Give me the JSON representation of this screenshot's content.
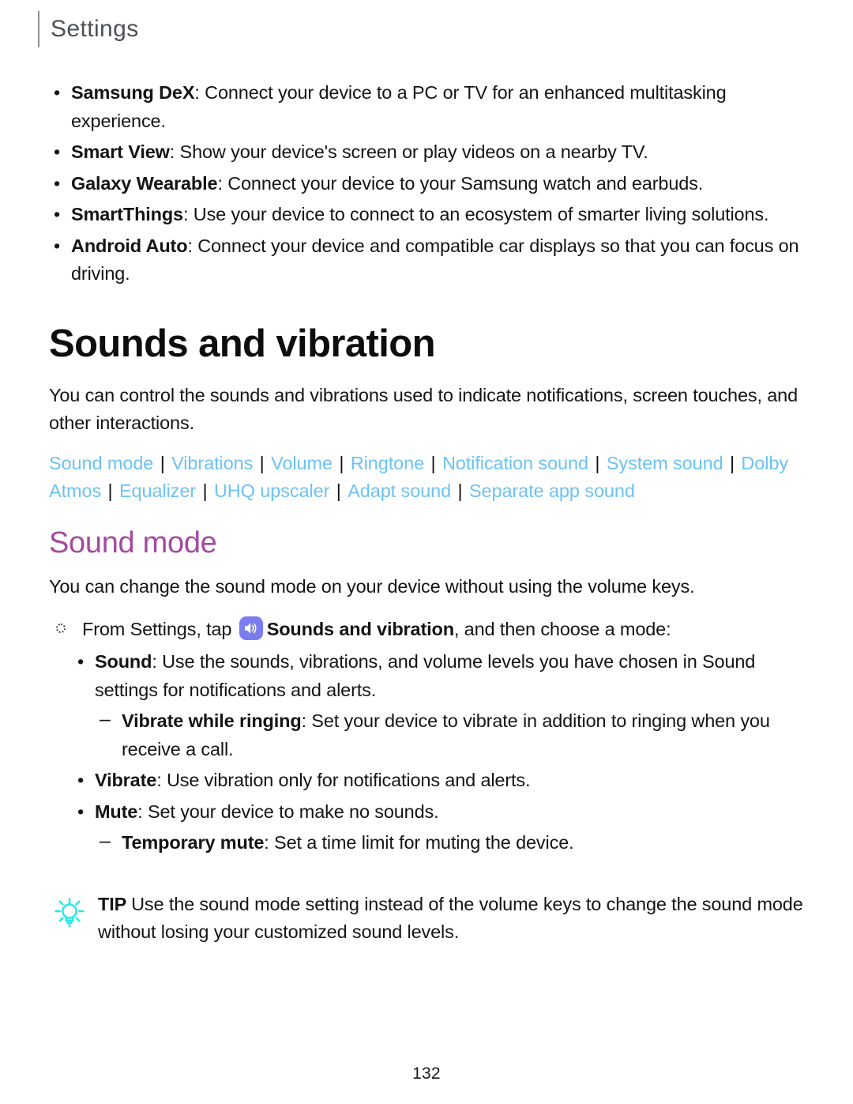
{
  "header": {
    "title": "Settings"
  },
  "top_bullets": [
    {
      "term": "Samsung DeX",
      "text": ": Connect your device to a PC or TV for an enhanced multitasking experience."
    },
    {
      "term": "Smart View",
      "text": ": Show your device's screen or play videos on a nearby TV."
    },
    {
      "term": "Galaxy Wearable",
      "text": ": Connect your device to your Samsung watch and earbuds."
    },
    {
      "term": "SmartThings",
      "text": ": Use your device to connect to an ecosystem of smarter living solutions."
    },
    {
      "term": "Android Auto",
      "text": ": Connect your device and compatible car displays so that you can focus on driving."
    }
  ],
  "section": {
    "heading": "Sounds and vibration",
    "intro": "You can control the sounds and vibrations used to indicate notifications, screen touches, and other interactions."
  },
  "links": {
    "separator": "|",
    "items": [
      "Sound mode",
      "Vibrations",
      "Volume",
      "Ringtone",
      "Notification sound",
      "System sound",
      "Dolby Atmos",
      "Equalizer",
      "UHQ upscaler",
      "Adapt sound",
      "Separate app sound"
    ]
  },
  "subsection": {
    "heading": "Sound mode",
    "intro": "You can change the sound mode on your device without using the volume keys.",
    "step": {
      "text_before_icon": "From Settings, tap ",
      "icon_name": "sounds-and-vibration-app-icon",
      "bold_text": "Sounds and vibration",
      "text_after_bold": ", and then choose a mode:"
    },
    "modes": [
      {
        "term": "Sound",
        "text": ": Use the sounds, vibrations, and volume levels you have chosen in Sound settings for notifications and alerts.",
        "sub": [
          {
            "term": "Vibrate while ringing",
            "text": ": Set your device to vibrate in addition to ringing when you receive a call."
          }
        ]
      },
      {
        "term": "Vibrate",
        "text": ": Use vibration only for notifications and alerts.",
        "sub": []
      },
      {
        "term": "Mute",
        "text": ": Set your device to make no sounds.",
        "sub": [
          {
            "term": "Temporary mute",
            "text": ": Set a time limit for muting the device."
          }
        ]
      }
    ]
  },
  "tip": {
    "label": "TIP",
    "text": "Use the sound mode setting instead of the volume keys to change the sound mode without losing your customized sound levels."
  },
  "footer": {
    "page_number": "132"
  },
  "colors": {
    "link": "#6cc2f5",
    "subheading": "#a34aa0",
    "tip_icon": "#2ee6e6",
    "app_icon_bg": "#7b7ced",
    "header_text": "#4c5156"
  },
  "markers": {
    "bullet": "•",
    "dash": "–"
  }
}
